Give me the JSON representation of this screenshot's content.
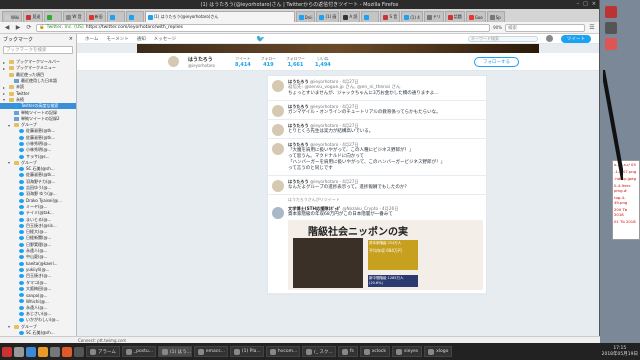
{
  "window": {
    "title": "(1) はうたろう(@ieyorhotaro)さん | Twitterからの返信付きツイート - Mozilla Firefox",
    "controls": [
      "–",
      "□",
      "×"
    ]
  },
  "tabs": [
    {
      "label": "Wiki",
      "color": "#ccc",
      "active": false
    },
    {
      "label": "見送",
      "color": "#c33",
      "active": false
    },
    {
      "label": "",
      "color": "#3a3",
      "active": false
    },
    {
      "label": "W 音",
      "color": "#888",
      "active": false
    },
    {
      "label": "新旧",
      "color": "#d33",
      "active": false
    },
    {
      "label": "",
      "color": "#1da1f2",
      "active": false
    },
    {
      "label": "",
      "color": "#1da1f2",
      "active": false
    },
    {
      "label": "(1) はうたろう(@ieyorhotaro)さん",
      "color": "#1da1f2",
      "active": true
    },
    {
      "label": "Dnii",
      "color": "#1da1f2",
      "active": false
    },
    {
      "label": "(1) 画",
      "color": "#1da1f2",
      "active": false
    },
    {
      "label": "A 読",
      "color": "#333",
      "active": false
    },
    {
      "label": "",
      "color": "#1da1f2",
      "active": false
    },
    {
      "label": "S 音",
      "color": "#c33",
      "active": false
    },
    {
      "label": "(1) 4",
      "color": "#1da1f2",
      "active": false
    },
    {
      "label": "ドリ",
      "color": "#777",
      "active": false
    },
    {
      "label": "話題",
      "color": "#c33",
      "active": false
    },
    {
      "label": "Goo",
      "color": "#e33",
      "active": false
    },
    {
      "label": "Sp",
      "color": "#777",
      "active": false
    }
  ],
  "nav": {
    "back": "◀",
    "forward": "▶",
    "reload": "⟳",
    "site_label": "Twitter, Inc. (US)",
    "url": "https://twitter.com/ieyorhotaro/with_replies",
    "zoom": "90%",
    "search_placeholder": "検索",
    "menu": "☰"
  },
  "sidebar": {
    "title": "ブックマーク",
    "close": "×",
    "search_placeholder": "ブックマークを検索",
    "items": [
      {
        "label": "ブックマークツールバー",
        "type": "folder",
        "indent": 0,
        "arrow": "▸"
      },
      {
        "label": "ブックマークメニュー",
        "type": "folder",
        "indent": 0,
        "arrow": "▸"
      },
      {
        "label": "最近使った項目",
        "type": "folder",
        "indent": 0,
        "arrow": ""
      },
      {
        "label": "最近使用した日本語",
        "type": "page",
        "indent": 1,
        "arrow": ""
      },
      {
        "label": "未読",
        "type": "folder",
        "indent": 0,
        "arrow": "▸"
      },
      {
        "label": "Twitter",
        "type": "folder",
        "indent": 0,
        "arrow": "▸"
      },
      {
        "label": "永続",
        "type": "folder",
        "indent": 0,
        "arrow": "▾"
      },
      {
        "label": "Twitterの高度な検索",
        "type": "tw",
        "indent": 1,
        "arrow": "",
        "selected": true
      },
      {
        "label": "単純ツイートの記録",
        "type": "page",
        "indent": 1,
        "arrow": ""
      },
      {
        "label": "単純ツイートの記録2",
        "type": "page",
        "indent": 1,
        "arrow": ""
      },
      {
        "label": "グループ",
        "type": "folder",
        "indent": 1,
        "arrow": "▾"
      },
      {
        "label": "佐藤淑恵(@tk...",
        "type": "tw",
        "indent": 2,
        "arrow": ""
      },
      {
        "label": "佐藤淑恵(@tk...",
        "type": "tw",
        "indent": 2,
        "arrow": ""
      },
      {
        "label": "小林秀明(@...",
        "type": "tw",
        "indent": 2,
        "arrow": ""
      },
      {
        "label": "小林秀明(@...",
        "type": "tw",
        "indent": 2,
        "arrow": ""
      },
      {
        "label": "サラサ(@s...",
        "type": "tw",
        "indent": 2,
        "arrow": ""
      },
      {
        "label": "グループ",
        "type": "folder",
        "indent": 1,
        "arrow": "▾"
      },
      {
        "label": "SC 石美(@sh...",
        "type": "tw",
        "indent": 2,
        "arrow": ""
      },
      {
        "label": "佐藤淑恵(@tk...",
        "type": "tw",
        "indent": 2,
        "arrow": ""
      },
      {
        "label": "羽海野チカ(@...",
        "type": "tw",
        "indent": 2,
        "arrow": ""
      },
      {
        "label": "吉田ゆう(@...",
        "type": "tw",
        "indent": 2,
        "arrow": ""
      },
      {
        "label": "羽海野 ゆう(@...",
        "type": "tw",
        "indent": 2,
        "arrow": ""
      },
      {
        "label": "Drako Tyaisei(@...",
        "type": "tw",
        "indent": 2,
        "arrow": ""
      },
      {
        "label": "ミーヤ(@...",
        "type": "tw",
        "indent": 2,
        "arrow": ""
      },
      {
        "label": "テイミ(@tak...",
        "type": "tw",
        "indent": 2,
        "arrow": ""
      },
      {
        "label": "まいとる(@...",
        "type": "tw",
        "indent": 2,
        "arrow": ""
      },
      {
        "label": "目玉焼き(@sis...",
        "type": "tw",
        "indent": 2,
        "arrow": ""
      },
      {
        "label": "日経大(@...",
        "type": "tw",
        "indent": 2,
        "arrow": ""
      },
      {
        "label": "日経新聞(@...",
        "type": "tw",
        "indent": 2,
        "arrow": ""
      },
      {
        "label": "日野実理(@...",
        "type": "tw",
        "indent": 2,
        "arrow": ""
      },
      {
        "label": "永遠人(@...",
        "type": "tw",
        "indent": 2,
        "arrow": ""
      },
      {
        "label": "中山夏(@...",
        "type": "tw",
        "indent": 2,
        "arrow": ""
      },
      {
        "label": "kaeita(@kaeri...",
        "type": "tw",
        "indent": 2,
        "arrow": ""
      },
      {
        "label": "yukiiyli(@...",
        "type": "tw",
        "indent": 2,
        "arrow": ""
      },
      {
        "label": "目玉焼き(@...",
        "type": "tw",
        "indent": 2,
        "arrow": ""
      },
      {
        "label": "タマコ(@...",
        "type": "tw",
        "indent": 2,
        "arrow": ""
      },
      {
        "label": "大阪梅田(@...",
        "type": "tw",
        "indent": 2,
        "arrow": ""
      },
      {
        "label": "sanpo(@...",
        "type": "tw",
        "indent": 2,
        "arrow": ""
      },
      {
        "label": "Whichi(@...",
        "type": "tw",
        "indent": 2,
        "arrow": ""
      },
      {
        "label": "永遠人(@...",
        "type": "tw",
        "indent": 2,
        "arrow": ""
      },
      {
        "label": "あじさい(@...",
        "type": "tw",
        "indent": 2,
        "arrow": ""
      },
      {
        "label": "いかがわしい(@...",
        "type": "tw",
        "indent": 2,
        "arrow": ""
      },
      {
        "label": "グループ",
        "type": "folder",
        "indent": 1,
        "arrow": "▾"
      },
      {
        "label": "SC 石美(@sh...",
        "type": "tw",
        "indent": 2,
        "arrow": ""
      }
    ]
  },
  "twitter_nav": {
    "home": "ホーム",
    "moments": "モーメント",
    "notifications": "通知",
    "messages": "メッセージ",
    "search_placeholder": "キーワード検索",
    "tweet_button": "ツイート"
  },
  "profile": {
    "name": "はうたろう",
    "handle": "@ieyorhotaro",
    "stats": [
      {
        "label": "ツイート",
        "value": "8,414"
      },
      {
        "label": "フォロー",
        "value": "419"
      },
      {
        "label": "フォロワー",
        "value": "1,661"
      },
      {
        "label": "いいね",
        "value": "1,494"
      }
    ],
    "follow_button": "フォローする"
  },
  "tweets": [
    {
      "name": "はうたろう",
      "handle": "@ieyorhotaro · 4月27日",
      "reply_to": "返信先: @sensu_vogue.jp さん, @en_ni_thenai さん",
      "text": "ちょっとすいませんが、ジャックちゃんに3万お金かした橋の通りますよ…"
    },
    {
      "name": "はうたろう",
      "handle": "@ieyorhotaro · 4月27日",
      "reply_to": "",
      "text": "ガンマゲイル・オンラインのチュートリアルの教育係ってらかもたらいな。"
    },
    {
      "name": "はうたろう",
      "handle": "@ieyorhotaro · 4月27日",
      "reply_to": "",
      "text": "とりとくろ先生は実力が結構高いでいる。"
    },
    {
      "name": "はうたろう",
      "handle": "@ieyorhotaro · 4月27日",
      "reply_to": "",
      "text": "「大魔を肩用に扱いやがって、この人種にビジネス野郎が！」\nって思うん。マクドナルドに向かって\n「ハンバーガーを肩用に扱いやがって、このハンバーガービジネス野郎が！」\nって言うのと同じです"
    },
    {
      "name": "はうたろう",
      "handle": "@ieyorhotaro · 4月27日",
      "reply_to": "",
      "text": "なんだよグループの進捗表示って。進捗報酬でもしたのか？"
    }
  ],
  "retweet": {
    "note": "はうたろうさんがリツイート",
    "name": "文学博士(STH応援隊)ﾎﾟｯﾎﾟ",
    "handle": "@Nozaku_Crypto · 4月26日",
    "text": "資本家階級の年収68万円がこの日本階層が一番みて",
    "image_title": "階級社会ニッポンの実",
    "image_labels": [
      "資本家階級 254万人",
      "平均年収 684万円",
      "新中間階級 1285万人 (20.6%)"
    ]
  },
  "statusbar": "Connect: ptt.twimg.com",
  "taskbar": {
    "tasks": [
      "アラーム",
      "_postu...",
      "(1) はう...",
      "emacs...",
      "(1) Pla...",
      "hvcom...",
      "r_ スク...",
      "fs",
      "xclock",
      "sieyes",
      "xlogo"
    ],
    "time": "17:15",
    "date": "2018年05月19日"
  },
  "desktop_window": {
    "lines": [
      "x-1p-s.r/ 05",
      "-1-4-07.png",
      "-hdr1p.jpeg",
      "0-4-9ver-pmg.#",
      "rog-4-49.png",
      "200 Tb 2018",
      "01 Tb 2018"
    ]
  }
}
